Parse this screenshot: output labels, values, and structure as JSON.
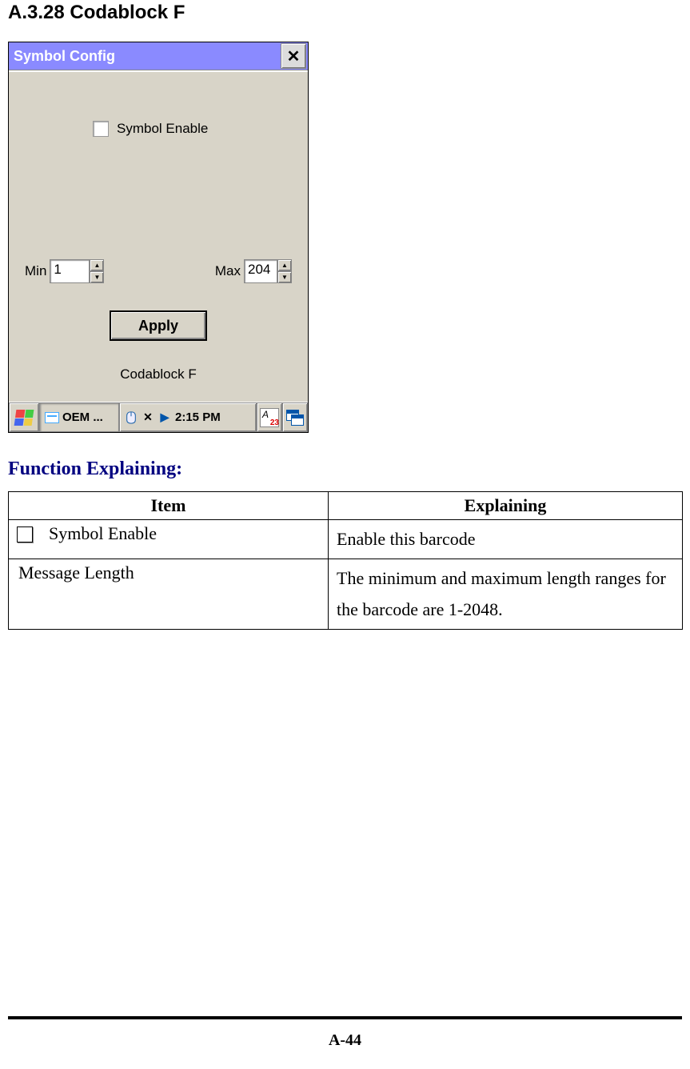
{
  "heading": "A.3.28 Codablock F",
  "window": {
    "title": "Symbol Config",
    "checkbox_label": "Symbol Enable",
    "min_label": "Min",
    "min_value": "1",
    "max_label": "Max",
    "max_value": "204",
    "apply_label": "Apply",
    "type_label": "Codablock F"
  },
  "taskbar": {
    "task_label": "OEM ...",
    "time": "2:15 PM",
    "kb_symbol": "A",
    "kb_num": "23"
  },
  "explain_heading": "Function Explaining:",
  "table": {
    "headers": {
      "item": "Item",
      "explaining": "Explaining"
    },
    "rows": [
      {
        "item": "Symbol Enable",
        "explaining": "Enable this barcode",
        "has_checkbox": true
      },
      {
        "item": "Message Length",
        "explaining": "The minimum and maximum length ranges for the barcode are 1-2048.",
        "has_checkbox": false
      }
    ]
  },
  "page_number": "A-44"
}
